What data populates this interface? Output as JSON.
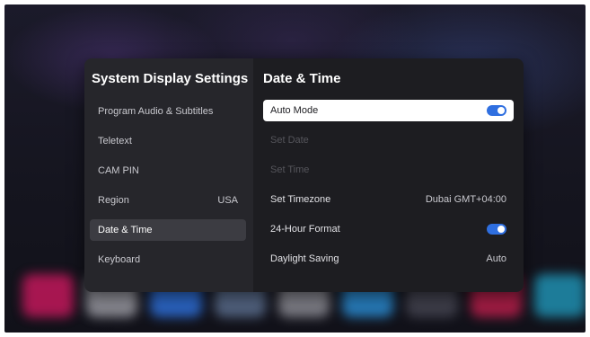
{
  "colors": {
    "accent": "#2f6fe0",
    "focus_bg": "#ffffff",
    "selected_bg": "#3c3c42"
  },
  "sidebar": {
    "title": "System Display Settings",
    "items": [
      {
        "label": "Program Audio & Subtitles",
        "value": ""
      },
      {
        "label": "Teletext",
        "value": ""
      },
      {
        "label": "CAM PIN",
        "value": ""
      },
      {
        "label": "Region",
        "value": "USA"
      },
      {
        "label": "Date & Time",
        "value": "",
        "selected": true
      },
      {
        "label": "Keyboard",
        "value": ""
      }
    ]
  },
  "main": {
    "title": "Date & Time",
    "rows": [
      {
        "label": "Auto Mode",
        "toggle_on": true,
        "focused": true
      },
      {
        "label": "Set Date",
        "disabled": true
      },
      {
        "label": "Set Time",
        "disabled": true
      },
      {
        "label": "Set Timezone",
        "value": "Dubai GMT+04:00"
      },
      {
        "label": "24-Hour Format",
        "toggle_on": true
      },
      {
        "label": "Daylight Saving",
        "value": "Auto"
      }
    ]
  }
}
